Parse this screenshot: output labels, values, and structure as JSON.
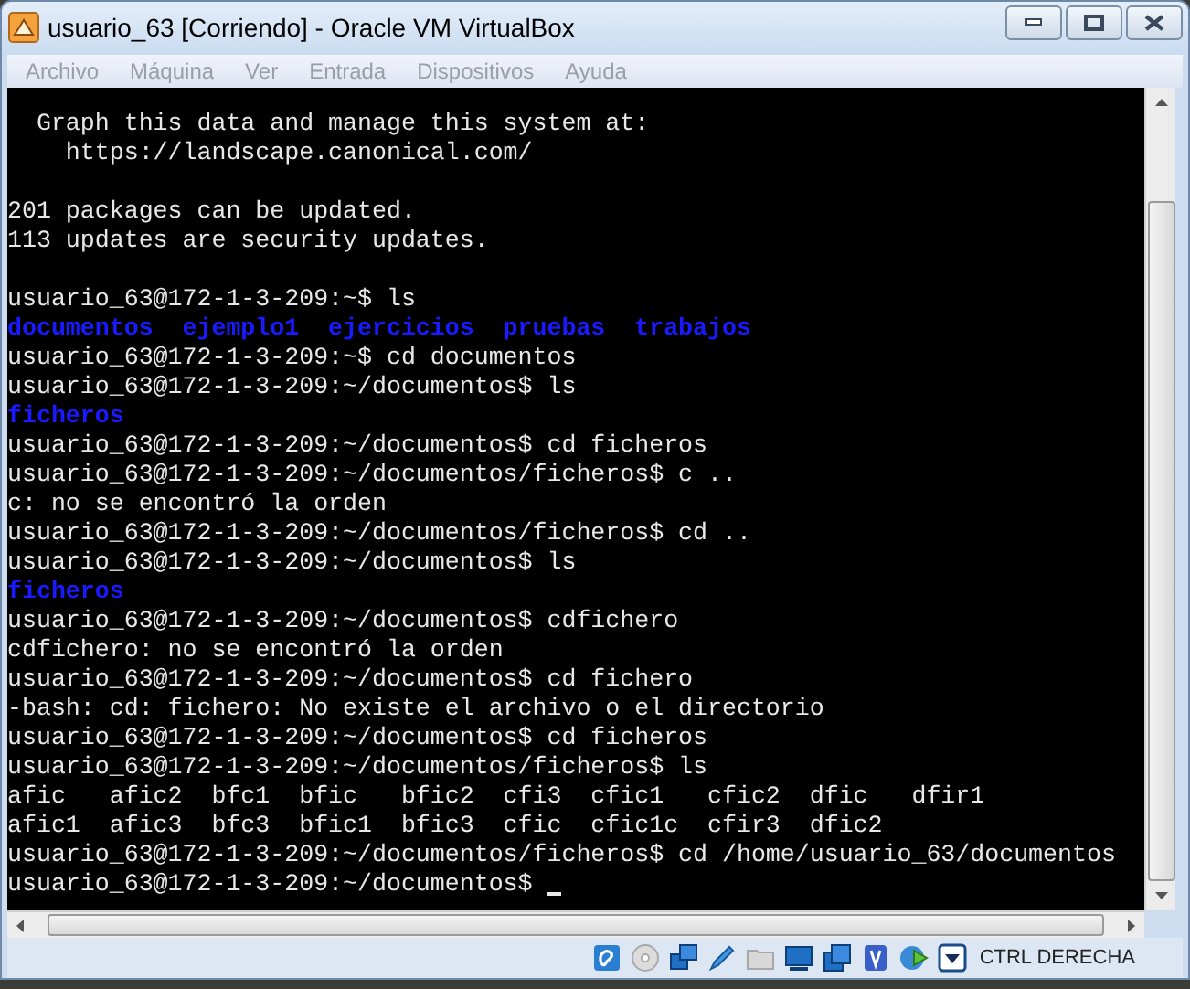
{
  "window": {
    "title": "usuario_63 [Corriendo] - Oracle VM VirtualBox"
  },
  "menu": [
    {
      "label": "Archivo",
      "disabled": true
    },
    {
      "label": "Máquina",
      "disabled": true
    },
    {
      "label": "Ver",
      "disabled": true
    },
    {
      "label": "Entrada",
      "disabled": true
    },
    {
      "label": "Dispositivos",
      "disabled": true
    },
    {
      "label": "Ayuda",
      "disabled": true
    }
  ],
  "terminal": {
    "cursor_visible": true,
    "lines": [
      {
        "kind": "text",
        "text": "  Graph this data and manage this system at:"
      },
      {
        "kind": "text",
        "text": "    https://landscape.canonical.com/"
      },
      {
        "kind": "blank"
      },
      {
        "kind": "text",
        "text": "201 packages can be updated."
      },
      {
        "kind": "text",
        "text": "113 updates are security updates."
      },
      {
        "kind": "blank"
      },
      {
        "kind": "text",
        "text": "usuario_63@172-1-3-209:~$ ls"
      },
      {
        "kind": "dir",
        "text": "documentos  ejemplo1  ejercicios  pruebas  trabajos"
      },
      {
        "kind": "text",
        "text": "usuario_63@172-1-3-209:~$ cd documentos"
      },
      {
        "kind": "text",
        "text": "usuario_63@172-1-3-209:~/documentos$ ls"
      },
      {
        "kind": "dir",
        "text": "ficheros"
      },
      {
        "kind": "text",
        "text": "usuario_63@172-1-3-209:~/documentos$ cd ficheros"
      },
      {
        "kind": "text",
        "text": "usuario_63@172-1-3-209:~/documentos/ficheros$ c .."
      },
      {
        "kind": "text",
        "text": "c: no se encontró la orden"
      },
      {
        "kind": "text",
        "text": "usuario_63@172-1-3-209:~/documentos/ficheros$ cd .."
      },
      {
        "kind": "text",
        "text": "usuario_63@172-1-3-209:~/documentos$ ls"
      },
      {
        "kind": "dir",
        "text": "ficheros"
      },
      {
        "kind": "text",
        "text": "usuario_63@172-1-3-209:~/documentos$ cdfichero"
      },
      {
        "kind": "text",
        "text": "cdfichero: no se encontró la orden"
      },
      {
        "kind": "text",
        "text": "usuario_63@172-1-3-209:~/documentos$ cd fichero"
      },
      {
        "kind": "text",
        "text": "-bash: cd: fichero: No existe el archivo o el directorio"
      },
      {
        "kind": "text",
        "text": "usuario_63@172-1-3-209:~/documentos$ cd ficheros"
      },
      {
        "kind": "text",
        "text": "usuario_63@172-1-3-209:~/documentos/ficheros$ ls"
      },
      {
        "kind": "text",
        "text": "afic   afic2  bfc1  bfic   bfic2  cfi3  cfic1   cfic2  dfic   dfir1"
      },
      {
        "kind": "text",
        "text": "afic1  afic3  bfc3  bfic1  bfic3  cfic  cfic1c  cfir3  dfic2"
      },
      {
        "kind": "text",
        "text": "usuario_63@172-1-3-209:~/documentos/ficheros$ cd /home/usuario_63/documentos"
      },
      {
        "kind": "text",
        "text": "usuario_63@172-1-3-209:~/documentos$"
      }
    ]
  },
  "status_bar": {
    "host_key": "CTRL DERECHA"
  }
}
